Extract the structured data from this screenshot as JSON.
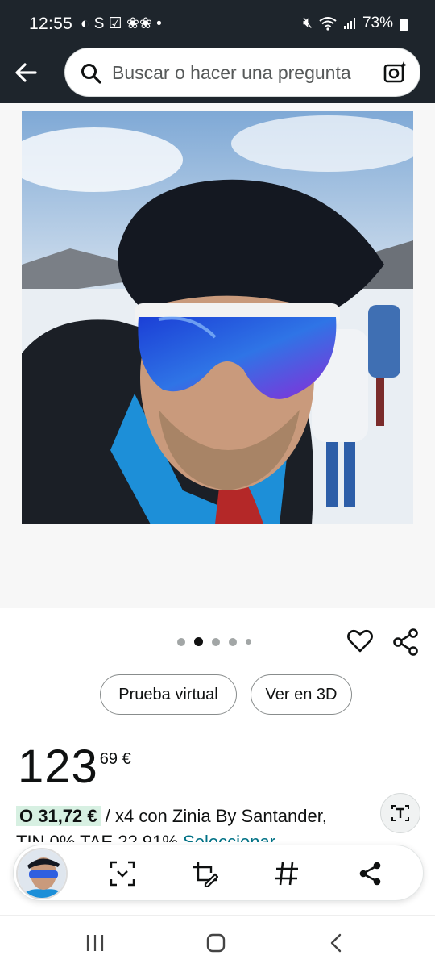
{
  "status_bar": {
    "time": "12:55",
    "left_glyphs": "◐ S ☑ ❀❀ •",
    "battery": "73%"
  },
  "search": {
    "placeholder": "Buscar o hacer una pregunta"
  },
  "gallery": {
    "dot_count": 5,
    "active_index": 1
  },
  "actions": {
    "virtual_try": "Prueba virtual",
    "view_3d": "Ver en 3D"
  },
  "price": {
    "whole": "123",
    "fraction": "69 €"
  },
  "financing": {
    "amount": "O 31,72 €",
    "text": " / x4 con Zinia By Santander,",
    "line2_text": "TIN 0% TAE 22,91% ",
    "line2_link": "Seleccionar"
  },
  "translate_button": {
    "icon": "text-translate-icon"
  },
  "toolbar": {
    "icons": [
      "product-thumbnail",
      "scan-icon",
      "crop-edit-icon",
      "hashtag-icon",
      "share-icon"
    ]
  },
  "colors": {
    "header_bg": "#1e252c",
    "highlight_green": "#d7f0e2",
    "link": "#007185"
  }
}
